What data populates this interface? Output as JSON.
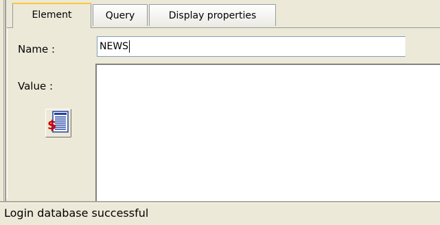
{
  "tabs": [
    {
      "label": "Element",
      "active": true
    },
    {
      "label": "Query",
      "active": false
    },
    {
      "label": "Display properties",
      "active": false
    }
  ],
  "form": {
    "name_label": "Name :",
    "name_value": "NEWS",
    "value_label": "Value :",
    "value_content": ""
  },
  "icons": {
    "value_button": "money-document-icon"
  },
  "status": {
    "text": "Login database successful"
  },
  "colors": {
    "panel": "#ece9d8",
    "active_tab_accent": "#ffc83c",
    "input_border": "#7f9db9",
    "dollar_sign": "#cc0000",
    "document_blue": "#1f3f9f"
  }
}
